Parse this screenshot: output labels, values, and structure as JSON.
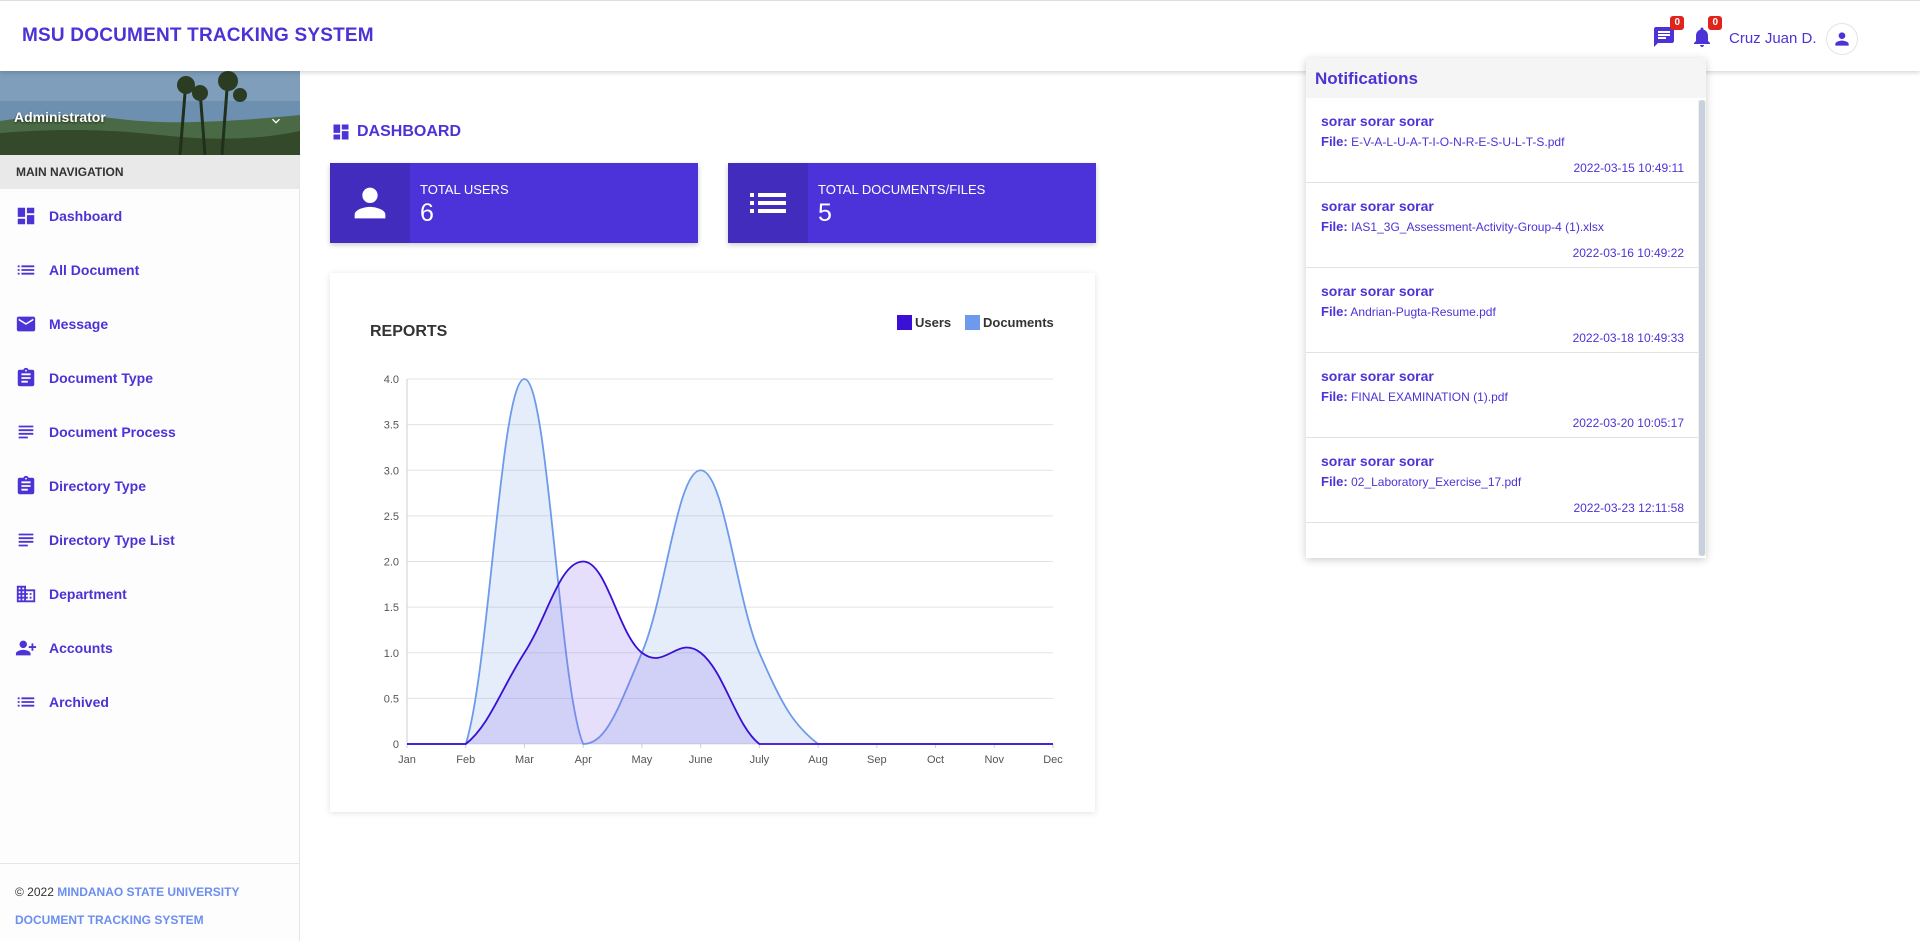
{
  "header": {
    "brand": "MSU DOCUMENT TRACKING SYSTEM",
    "messages_badge": "0",
    "notifications_badge": "0",
    "user_name": "Cruz Juan D.",
    "icons": {
      "messages": "chat-icon",
      "notifications": "bell-icon",
      "avatar": "person-icon"
    }
  },
  "sidebar": {
    "role": "Administrator",
    "nav_header": "MAIN NAVIGATION",
    "items": [
      {
        "label": "Dashboard",
        "icon": "dashboard-icon"
      },
      {
        "label": "All Document",
        "icon": "list-icon"
      },
      {
        "label": "Message",
        "icon": "mail-icon"
      },
      {
        "label": "Document Type",
        "icon": "clipboard-icon"
      },
      {
        "label": "Document Process",
        "icon": "lines-icon"
      },
      {
        "label": "Directory Type",
        "icon": "clipboard-icon"
      },
      {
        "label": "Directory Type List",
        "icon": "lines-icon"
      },
      {
        "label": "Department",
        "icon": "building-icon"
      },
      {
        "label": "Accounts",
        "icon": "person-add-icon"
      },
      {
        "label": "Archived",
        "icon": "list-icon"
      }
    ],
    "footer": {
      "copyright": "© 2022 ",
      "org_line1": "MINDANAO STATE UNIVERSITY",
      "org_line2": "DOCUMENT TRACKING SYSTEM"
    }
  },
  "main": {
    "page_title": "DASHBOARD",
    "stats": [
      {
        "label": "TOTAL USERS",
        "value": "6",
        "icon": "person-icon"
      },
      {
        "label": "TOTAL DOCUMENTS/FILES",
        "value": "5",
        "icon": "list-icon"
      }
    ]
  },
  "chart_data": {
    "type": "area",
    "title": "REPORTS",
    "categories": [
      "Jan",
      "Feb",
      "Mar",
      "Apr",
      "May",
      "June",
      "July",
      "Aug",
      "Sep",
      "Oct",
      "Nov",
      "Dec"
    ],
    "series": [
      {
        "name": "Users",
        "values": [
          0,
          0,
          1,
          2,
          1,
          1,
          0,
          0,
          0,
          0,
          0,
          0
        ],
        "color": "#3a0fd6"
      },
      {
        "name": "Documents",
        "values": [
          0,
          0,
          4,
          0,
          1,
          3,
          1,
          0,
          0,
          0,
          0,
          0
        ],
        "color": "#6d9aea"
      }
    ],
    "ylim": [
      0,
      4
    ],
    "yticks": [
      "0",
      "0.5",
      "1.0",
      "1.5",
      "2.0",
      "2.5",
      "3.0",
      "3.5",
      "4.0"
    ],
    "grid": true,
    "legend_position": "top-right"
  },
  "notifications": {
    "title": "Notifications",
    "items": [
      {
        "sender": "sorar sorar sorar",
        "file_label": "File:",
        "file": "E-V-A-L-U-A-T-I-O-N-R-E-S-U-L-T-S.pdf",
        "time": "2022-03-15 10:49:11"
      },
      {
        "sender": "sorar sorar sorar",
        "file_label": "File:",
        "file": "IAS1_3G_Assessment-Activity-Group-4 (1).xlsx",
        "time": "2022-03-16 10:49:22"
      },
      {
        "sender": "sorar sorar sorar",
        "file_label": "File:",
        "file": "Andrian-Pugta-Resume.pdf",
        "time": "2022-03-18 10:49:33"
      },
      {
        "sender": "sorar sorar sorar",
        "file_label": "File:",
        "file": "FINAL EXAMINATION (1).pdf",
        "time": "2022-03-20 10:05:17"
      },
      {
        "sender": "sorar sorar sorar",
        "file_label": "File:",
        "file": "02_Laboratory_Exercise_17.pdf",
        "time": "2022-03-23 12:11:58"
      }
    ]
  },
  "colors": {
    "primary": "#4b33d6",
    "card_bg": "#4c33d9",
    "badge": "#e0241c",
    "footer_link": "#6b8ef0"
  }
}
